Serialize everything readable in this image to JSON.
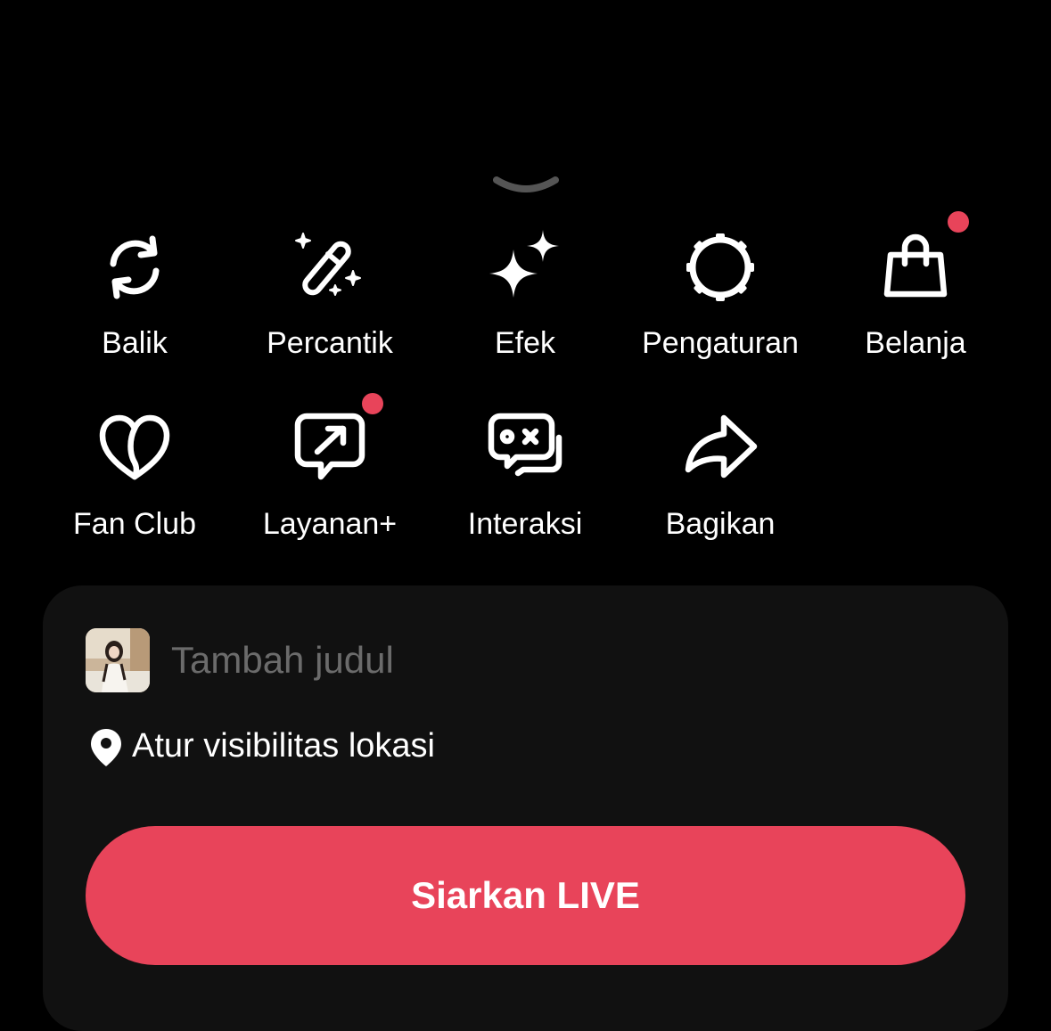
{
  "tools_row1": [
    {
      "label": "Balik",
      "icon": "flip-camera-icon",
      "badge": false
    },
    {
      "label": "Percantik",
      "icon": "magic-wand-icon",
      "badge": false
    },
    {
      "label": "Efek",
      "icon": "sparkles-icon",
      "badge": false
    },
    {
      "label": "Pengaturan",
      "icon": "gear-icon",
      "badge": false
    },
    {
      "label": "Belanja",
      "icon": "shopping-bag-icon",
      "badge": true
    }
  ],
  "tools_row2": [
    {
      "label": "Fan Club",
      "icon": "heart-icon",
      "badge": false
    },
    {
      "label": "Layanan+",
      "icon": "chat-arrow-icon",
      "badge": true
    },
    {
      "label": "Interaksi",
      "icon": "game-chat-icon",
      "badge": false
    },
    {
      "label": "Bagikan",
      "icon": "share-arrow-icon",
      "badge": false
    }
  ],
  "setup": {
    "title_placeholder": "Tambah judul",
    "title_value": "",
    "location_label": "Atur visibilitas lokasi",
    "go_live_label": "Siarkan LIVE"
  },
  "colors": {
    "background": "#000000",
    "card": "#111111",
    "accent": "#e8445a",
    "badge": "#e8445a",
    "placeholder": "#6b6b6b"
  }
}
